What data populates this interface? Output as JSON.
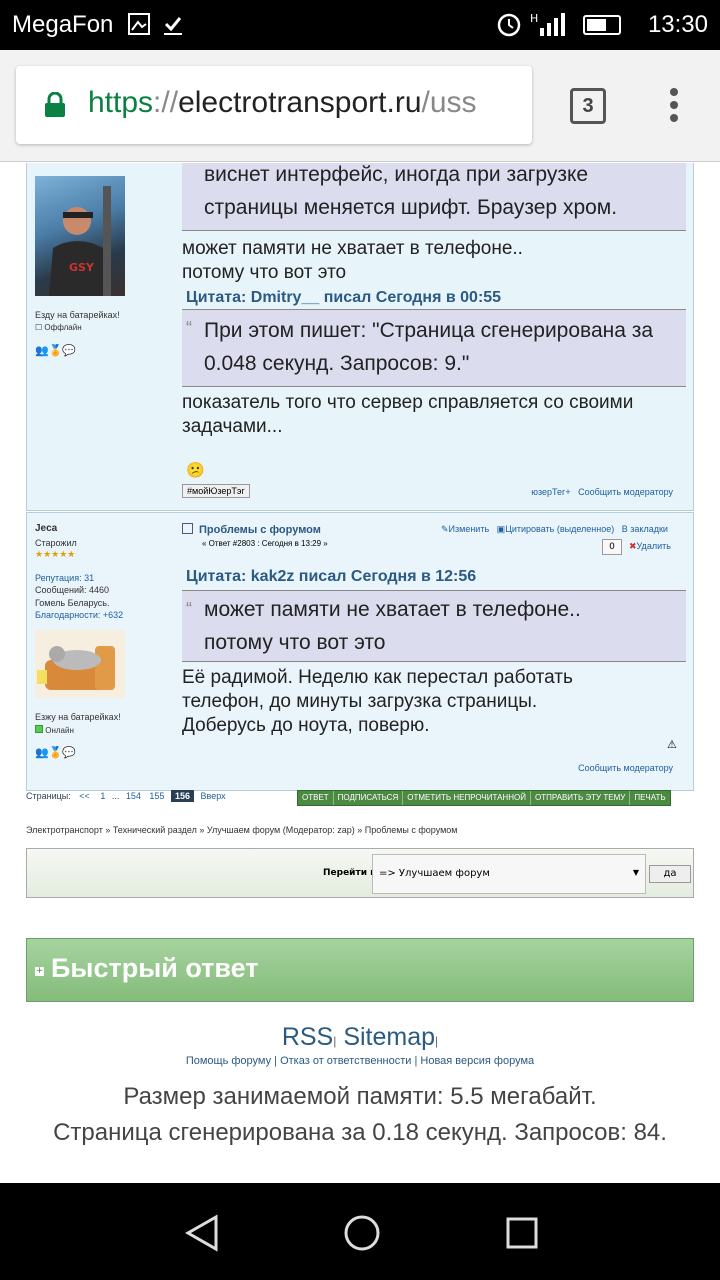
{
  "status": {
    "carrier": "MegaFon",
    "time": "13:30"
  },
  "browser": {
    "url_scheme": "https",
    "url_sep": "://",
    "url_host": "electrotransport.ru",
    "url_path": "/uss",
    "tabs_count": "3"
  },
  "post1": {
    "user_line": "Езду на батарейках!",
    "online": "Оффлайн",
    "quote1": [
      "виснет интерфейс, иногда при загрузке",
      "страницы меняется шрифт. Браузер хром."
    ],
    "text1": [
      "может памяти не хватает в телефоне..",
      "потому что вот это"
    ],
    "quote2_head": "Цитата: Dmitry__ писал Сегодня в 00:55",
    "quote2": [
      "При этом пишет: \"Страница сгенерирована за",
      "0.048 секунд. Запросов: 9.\""
    ],
    "text2": [
      "показатель того что сервер справляется со своими",
      "задачами..."
    ],
    "tag": "#мойЮзерТэг",
    "usertag": "юзерТег+",
    "report": "Сообщить модератору"
  },
  "post2": {
    "name": "Jeca",
    "rank": "Старожил",
    "rep": "Репутация: 31",
    "msgs": "Сообщений: 4460",
    "city": "Гомель Беларусь.",
    "thanks": "Благодарности: +632",
    "user_line": "Езжу на батарейках!",
    "online": "Онлайн",
    "title": "Проблемы с форумом",
    "meta": "« Ответ #2803 : Сегодня в 13:29 »",
    "edit": "Изменить",
    "quote_btn": "Цитировать (выделенное)",
    "bookmark": "В закладки",
    "counter": "0",
    "delete": "Удалить",
    "quote_head": "Цитата: kak2z писал Сегодня в 12:56",
    "quote": [
      "может памяти не хватает в телефоне..",
      "потому что вот это"
    ],
    "text": [
      "Её радимой. Неделю как перестал работать",
      "телефон, до минуты загрузка страницы.",
      "Доберусь до ноута, поверю."
    ],
    "report": "Сообщить модератору"
  },
  "pagination": {
    "label": "Страницы:",
    "items": [
      "<<",
      "1",
      "...",
      "154",
      "155"
    ],
    "current": "156",
    "up": "Вверх"
  },
  "actions": [
    "ОТВЕТ",
    "ПОДПИСАТЬСЯ",
    "ОТМЕТИТЬ НЕПРОЧИТАННОЙ",
    "ОТПРАВИТЬ ЭТУ ТЕМУ",
    "ПЕЧАТЬ"
  ],
  "breadcrumb": "Электротранспорт » Технический раздел » Улучшаем форум (Модератор: zap) » Проблемы с форумом",
  "jump": {
    "label": "Перейти в:",
    "value": "=> Улучшаем форум",
    "go": "да"
  },
  "quick_reply": "Быстрый ответ",
  "footer": {
    "rss": "RSS",
    "sitemap": "Sitemap",
    "links": "Помощь форуму | Отказ от ответственности | Новая версия форума",
    "memory": "Размер занимаемой памяти: 5.5 мегабайт.",
    "generated": "Страница сгенерирована за 0.18 секунд. Запросов: 84."
  },
  "colors": {
    "accent": "#0b8043",
    "post_bg": "#e7f4fa",
    "quote_bg": "#dcdcef",
    "quick_bg": "#8cc084"
  }
}
